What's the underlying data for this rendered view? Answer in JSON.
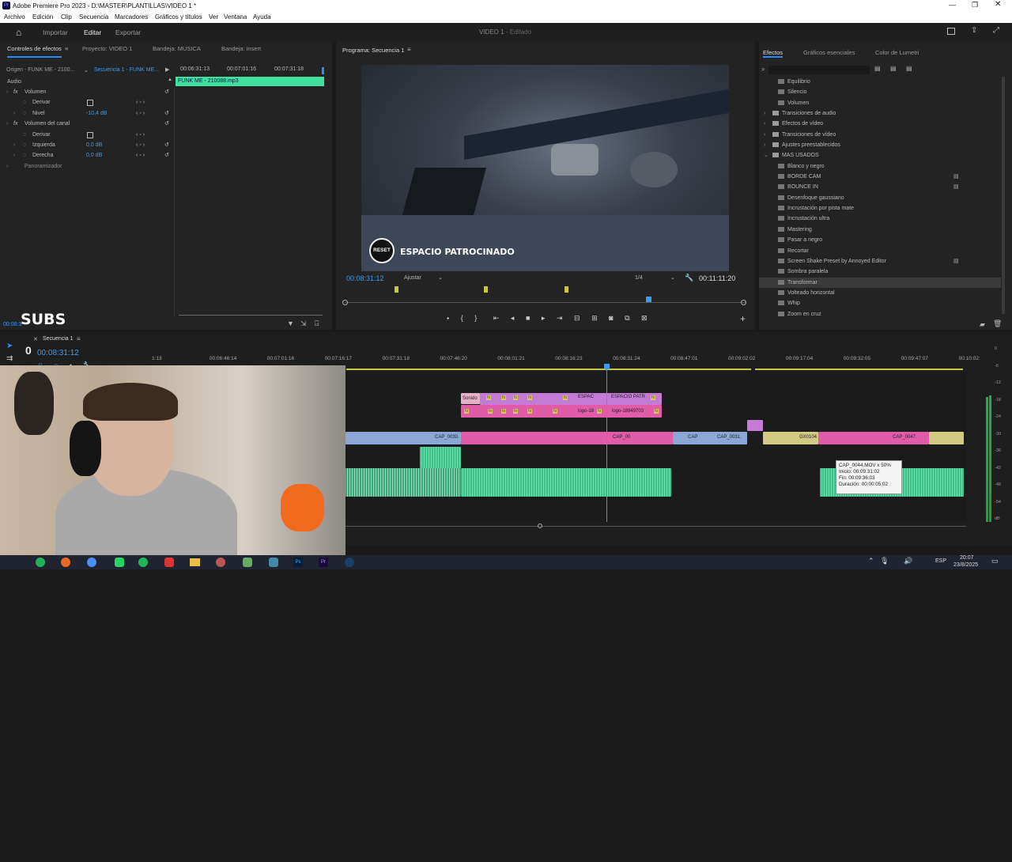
{
  "window": {
    "title": "Adobe Premiere Pro 2023 - D:\\MASTER\\PLANTILLAS\\VIDEO 1 *"
  },
  "menu": [
    "Archivo",
    "Edición",
    "Clip",
    "Secuencia",
    "Marcadores",
    "Gráficos y títulos",
    "Ver",
    "Ventana",
    "Ayuda"
  ],
  "workspace": {
    "tabs": [
      "Importar",
      "Editar",
      "Exportar"
    ],
    "project_title": "VIDEO 1",
    "status": "- Editado"
  },
  "effect_controls": {
    "tabs": [
      "Controles de efectos",
      "Proyecto: VIDEO 1",
      "Bandeja: MUSICA",
      "Bandeja: insert"
    ],
    "source": "Origen - FUNK ME - 2100...",
    "sequence": "Secuencia 1 - FUNK ME...",
    "timecodes": [
      "00:06:31:13",
      "00:07:01:16",
      "00:07:31:18"
    ],
    "clip_label": "FUNK ME - 210088.mp3",
    "section": "Audio",
    "rows": [
      {
        "name": "Volumen",
        "value": ""
      },
      {
        "name": "Derivar",
        "value": ""
      },
      {
        "name": "Nivel",
        "value": "-10,4 dB"
      },
      {
        "name": "Volumen del canal",
        "value": ""
      },
      {
        "name": "Derivar",
        "value": ""
      },
      {
        "name": "Izquierda",
        "value": "0,0 dB"
      },
      {
        "name": "Derecha",
        "value": "0,0 dB"
      },
      {
        "name": "Panoramizador",
        "value": ""
      }
    ],
    "overlay_text": "SUBS",
    "timecode": "00:08:3"
  },
  "program": {
    "title": "Programa: Secuencia 1",
    "timecode": "00:08:31:12",
    "fit": "Ajustar",
    "quality": "1/4",
    "duration": "00:11:11:20",
    "watermark": "ESPACIO PATROCINADO",
    "logo_text": "RESET"
  },
  "effects": {
    "tabs": [
      "Efectos",
      "Gráficos esenciales",
      "Color de Lumetri"
    ],
    "items": [
      {
        "label": "Equilibrio",
        "type": "item"
      },
      {
        "label": "Silencio",
        "type": "item"
      },
      {
        "label": "Volumen",
        "type": "item"
      },
      {
        "label": "Transiciones de audio",
        "type": "folder"
      },
      {
        "label": "Efectos de vídeo",
        "type": "folder"
      },
      {
        "label": "Transiciones de vídeo",
        "type": "folder"
      },
      {
        "label": "Ajustes preestablecidos",
        "type": "folder"
      },
      {
        "label": "MAS USADOS",
        "type": "folder-open"
      },
      {
        "label": "Blanco y negro",
        "type": "item"
      },
      {
        "label": "BORDE CAM",
        "type": "item"
      },
      {
        "label": "BOUNCE IN",
        "type": "item"
      },
      {
        "label": "Desenfoque gaussiano",
        "type": "item"
      },
      {
        "label": "Incrustación por pista mate",
        "type": "item"
      },
      {
        "label": "Incrustación ultra",
        "type": "item"
      },
      {
        "label": "Mastering",
        "type": "item"
      },
      {
        "label": "Pasar a negro",
        "type": "item"
      },
      {
        "label": "Recortar",
        "type": "item"
      },
      {
        "label": "Screen Shake Preset by Annoyed Editor",
        "type": "item"
      },
      {
        "label": "Sombra paralela",
        "type": "item"
      },
      {
        "label": "Transformar",
        "type": "selected"
      },
      {
        "label": "Volteado horizontal",
        "type": "item"
      },
      {
        "label": "Whip",
        "type": "item"
      },
      {
        "label": "Zoom en cruz",
        "type": "item"
      }
    ]
  },
  "timeline": {
    "tab": "Secuencia 1",
    "timecode": "00:08:31:12",
    "track_zero": "0",
    "ruler": [
      "1:13",
      "00:06:46:14",
      "00:07:01:16",
      "00:07:16:17",
      "00:07:31:18",
      "00:07:46:20",
      "00:08:01:21",
      "00:08:16:23",
      "00:08:31:24",
      "00:08:47:01",
      "00:09:02:02",
      "00:09:17:04",
      "00:09:32:05",
      "00:09:47:07",
      "00:10:02:"
    ],
    "clips_v3": [
      "fx",
      "fx",
      "fx",
      "ESPAC",
      "ESPACIO PATR",
      "fx"
    ],
    "clips_v3b": [
      "fx",
      "fx",
      "fx",
      "fx",
      "fx",
      "logo-18",
      "logo-18949703",
      "fx"
    ],
    "clip_sonido": "Sonido",
    "clips_v1": [
      "CAP_0030.",
      "CAP_00",
      "CAP",
      "CAP_0031.",
      "GX0104",
      "CAP_0047."
    ],
    "tooltip": {
      "name": "CAP_0044.MOV x 50%",
      "start": "Inicio: 00:09:31:02",
      "end": "Fin: 00:09:36:03",
      "duration": "Duración: 00:00:05:02"
    },
    "meter_ticks": [
      "0",
      "-6",
      "-12",
      "-18",
      "-24",
      "-30",
      "-36",
      "-42",
      "-48",
      "-54",
      "dB"
    ]
  },
  "taskbar": {
    "lang": "ESP",
    "time": "20:07",
    "date": "23/8/2025"
  },
  "colors": {
    "accent": "#2d8ceb",
    "pink": "#e05ca8",
    "green": "#46c38c",
    "blue": "#8aa7d6"
  }
}
